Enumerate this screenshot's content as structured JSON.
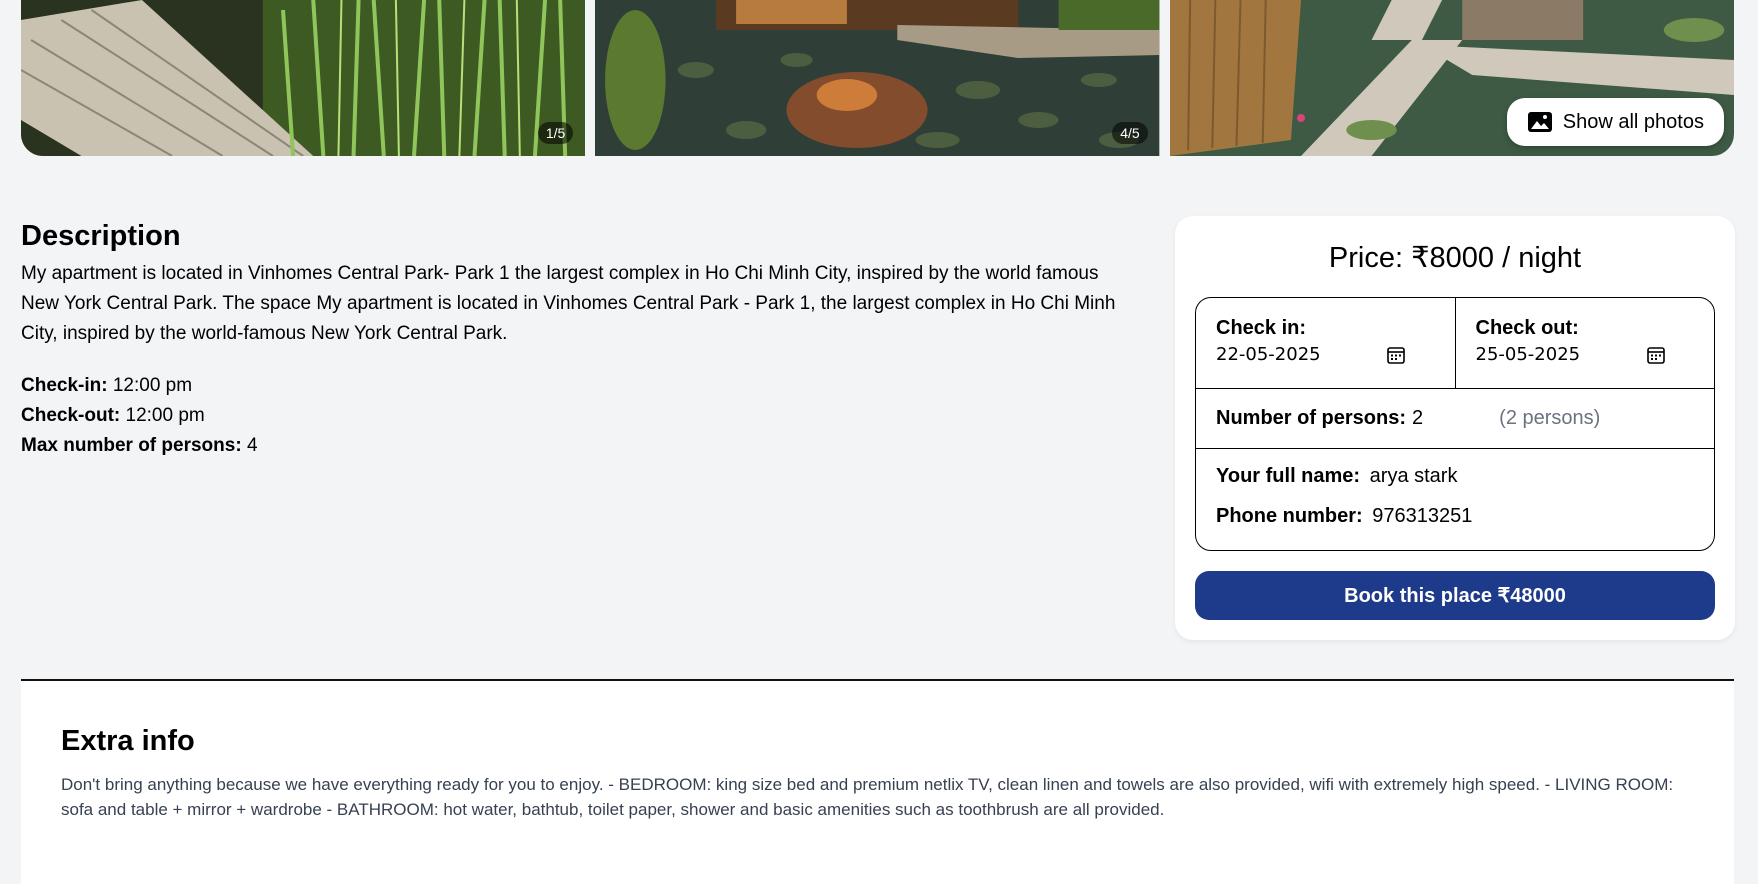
{
  "gallery": {
    "photos": [
      {
        "counter": "1/5"
      },
      {
        "counter": "4/5"
      },
      {
        "counter": ""
      }
    ],
    "show_all_label": "Show all photos"
  },
  "description": {
    "heading": "Description",
    "text": "My apartment is located in Vinhomes Central Park- Park 1 the largest complex in Ho Chi Minh City, inspired by the world famous New York Central Park. The space My apartment is located in Vinhomes Central Park - Park 1, the largest complex in Ho Chi Minh City, inspired by the world-famous New York Central Park.",
    "checkin_label": "Check-in:",
    "checkin_value": "12:00 pm",
    "checkout_label": "Check-out:",
    "checkout_value": "12:00 pm",
    "max_label": "Max number of persons:",
    "max_value": "4"
  },
  "booking": {
    "price": "Price: ₹8000 / night",
    "checkin_label": "Check in:",
    "checkin_value": "22-05-2025",
    "checkout_label": "Check out:",
    "checkout_value": "25-05-2025",
    "persons_label": "Number of persons:",
    "persons_value": "2",
    "persons_hint": "(2 persons)",
    "name_label": "Your full name:",
    "name_value": "arya stark",
    "phone_label": "Phone number:",
    "phone_value": "976313251",
    "book_label": "Book this place ₹48000",
    "accent_color": "#1e3a8a"
  },
  "extra": {
    "heading": "Extra info",
    "text": "Don't bring anything because we have everything ready for you to enjoy. - BEDROOM: king size bed and premium netlix TV, clean linen and towels are also provided, wifi with extremely high speed. - LIVING ROOM: sofa and table + mirror + wardrobe - BATHROOM: hot water, bathtub, toilet paper, shower and basic amenities such as toothbrush are all provided."
  }
}
